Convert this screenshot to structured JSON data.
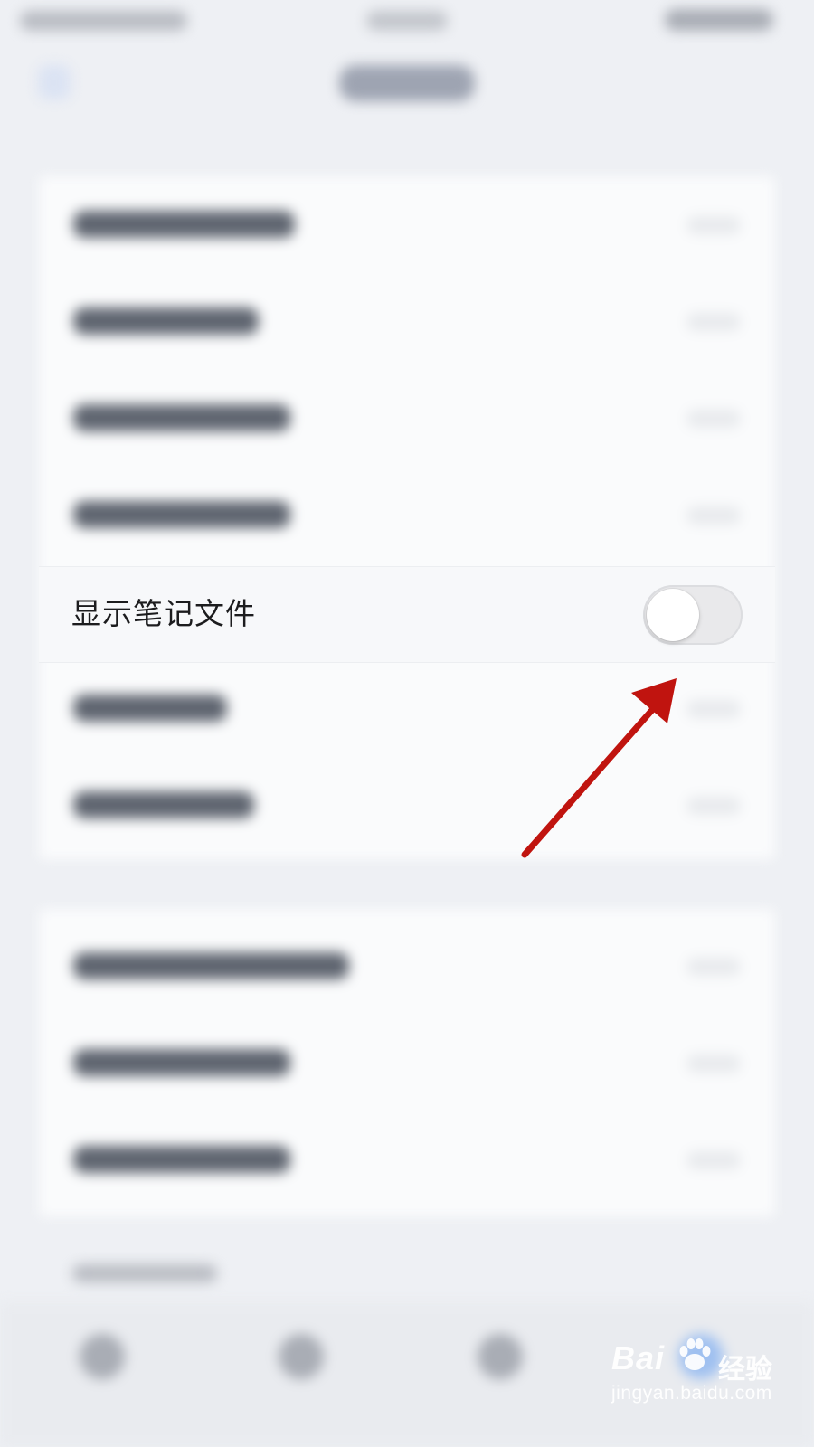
{
  "settings": {
    "highlighted_row": {
      "label": "显示笔记文件",
      "toggle_on": false
    }
  },
  "annotation": {
    "arrow_color": "#c0140f"
  },
  "watermark": {
    "brand": "Bai",
    "brand_suffix": "经验",
    "url": "jingyan.baidu.com"
  },
  "colors": {
    "background": "#eef0f4",
    "row_background": "#f7f8fa",
    "toggle_track_off": "#e9e9eb",
    "toggle_knob": "#ffffff"
  }
}
